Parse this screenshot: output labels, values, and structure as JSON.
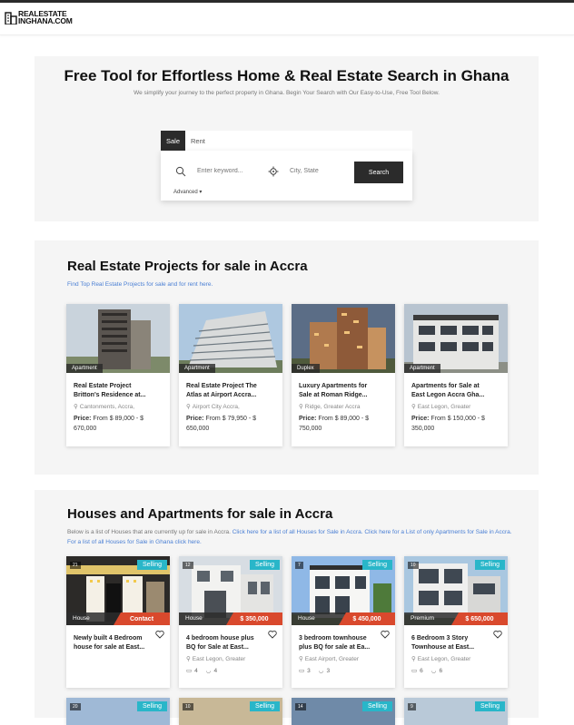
{
  "brand": {
    "line1": "REALESTATE",
    "line2": "INGHANA.COM"
  },
  "hero": {
    "title": "Free Tool for Effortless Home & Real Estate Search in Ghana",
    "subtitle": "We simplify your journey to the perfect property in Ghana. Begin Your Search with Our Easy-to-Use, Free Tool Below.",
    "tabs": [
      "Sale",
      "Rent"
    ],
    "keyword_placeholder": "Enter keyword...",
    "location_placeholder": "City, State",
    "search_label": "Search",
    "advanced_label": "Advanced ▾"
  },
  "projects": {
    "title": "Real Estate Projects for sale in Accra",
    "subtitle": "Find Top Real Estate Projects for sale and for rent here.",
    "items": [
      {
        "type": "Apartment",
        "title1": "Real Estate Project",
        "title2": "Britton's Residence at...",
        "location": "Cantonments, Accra,",
        "price_label": "Price:",
        "price1": "From $ 89,000 - $",
        "price2": "670,000"
      },
      {
        "type": "Apartment",
        "title1": "Real Estate Project The",
        "title2": "Atlas at Airport Accra...",
        "location": "Airport City Accra,",
        "price_label": "Price:",
        "price1": "From $ 79,950 - $",
        "price2": "650,000"
      },
      {
        "type": "Duplex",
        "title1": "Luxury Apartments for",
        "title2": "Sale at Roman Ridge...",
        "location": "Ridge, Greater Accra",
        "price_label": "Price:",
        "price1": "From $ 89,000 - $",
        "price2": "750,000"
      },
      {
        "type": "Apartment",
        "title1": "Apartments for Sale at",
        "title2": "East Legon Accra Gha...",
        "location": "East Legon, Greater",
        "price_label": "Price:",
        "price1": "From $ 150,000 - $",
        "price2": "350,000"
      }
    ]
  },
  "houses": {
    "title": "Houses and Apartments for sale in Accra",
    "intro": "Below is a list of Houses that are currently up for sale in Accra.",
    "link1": "Click here for a list of all Houses for Sale in Accra.",
    "link2": "Click here for a List of",
    "link3": "only Apartments for Sale in Accra.",
    "link4": "For a list of all Houses for Sale in Ghana click here.",
    "items": [
      {
        "count": "21",
        "status": "Selling",
        "type": "House",
        "price": "Contact",
        "title1": "Newly built 4 Bedroom",
        "title2": "house for sale at East...",
        "location": "",
        "beds": "",
        "baths": ""
      },
      {
        "count": "12",
        "status": "Selling",
        "type": "House",
        "price": "$ 350,000",
        "title1": "4 bedroom house plus",
        "title2": "BQ for Sale at East...",
        "location": "East Legon, Greater",
        "beds": "4",
        "baths": "4"
      },
      {
        "count": "7",
        "status": "Selling",
        "type": "House",
        "price": "$ 450,000",
        "title1": "3 bedroom townhouse",
        "title2": "plus BQ for sale at Ea...",
        "location": "East Airport, Greater",
        "beds": "3",
        "baths": "3"
      },
      {
        "count": "10",
        "status": "Selling",
        "type": "Premium",
        "price": "$ 650,000",
        "title1": "6 Bedroom 3 Story",
        "title2": "Townhouse at East...",
        "location": "East Legon, Greater",
        "beds": "6",
        "baths": "6"
      }
    ],
    "more": [
      {
        "count": "20",
        "status": "Selling"
      },
      {
        "count": "10",
        "status": "Selling"
      },
      {
        "count": "14",
        "status": "Selling"
      },
      {
        "count": "9",
        "status": "Selling"
      }
    ]
  },
  "colors": {
    "accent": "#29b6c9",
    "price_tag": "#d9492d",
    "dark": "#2b2b2b",
    "link": "#4a7fd4"
  }
}
